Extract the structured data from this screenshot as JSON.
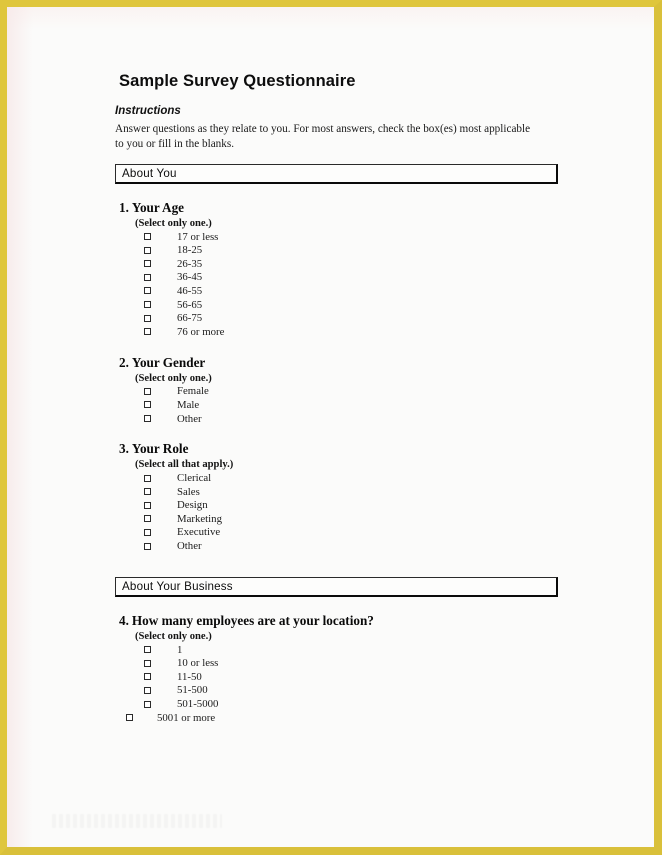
{
  "document": {
    "title": "Sample Survey Questionnaire",
    "instructions_heading": "Instructions",
    "instructions_body": "Answer questions as they relate to you. For most answers, check the box(es) most applicable to you or fill in the blanks."
  },
  "sections": [
    {
      "bar_label": "About You",
      "questions": [
        {
          "number": "1.",
          "title": "Your Age",
          "hint": "(Select only one.)",
          "options": [
            "17 or less",
            "18-25",
            "26-35",
            "36-45",
            "46-55",
            "56-65",
            "66-75",
            "76 or more"
          ]
        },
        {
          "number": "2.",
          "title": "Your Gender",
          "hint": "(Select only one.)",
          "options": [
            "Female",
            "Male",
            "Other"
          ]
        },
        {
          "number": "3.",
          "title": "Your Role",
          "hint": "(Select all that apply.)",
          "options": [
            "Clerical",
            "Sales",
            "Design",
            "Marketing",
            "Executive",
            "Other"
          ]
        }
      ]
    },
    {
      "bar_label": "About Your Business",
      "questions": [
        {
          "number": "4.",
          "title": "How many employees are at your location?",
          "hint": "(Select only one.)",
          "options": [
            "1",
            "10 or less",
            "11-50",
            "51-500",
            "501-5000",
            "5001 or more"
          ]
        }
      ]
    }
  ],
  "style": {
    "border_color": "#dfc63c",
    "page_background": "#fbfbfa",
    "text_color": "#1a1a1a"
  }
}
